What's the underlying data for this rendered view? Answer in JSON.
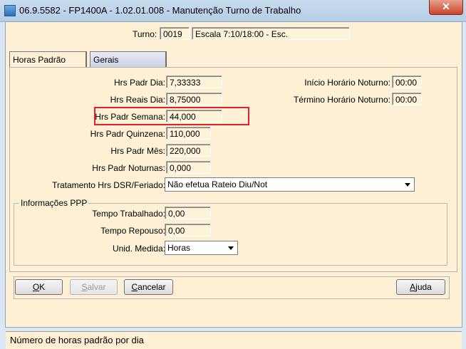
{
  "window": {
    "title": "06.9.5582 - FP1400A - 1.02.01.008 - Manutenção Turno de Trabalho",
    "close_glyph": "✕"
  },
  "header": {
    "turno_label": "Turno:",
    "turno_code": "0019",
    "turno_desc": "Escala 7:10/18:00 - Esc."
  },
  "tabs": [
    {
      "label": "Horas Padrão"
    },
    {
      "label": "Gerais"
    }
  ],
  "horas": {
    "padr_dia": {
      "label": "Hrs Padr Dia:",
      "value": "7,33333"
    },
    "reais_dia": {
      "label": "Hrs Reais Dia:",
      "value": "8,75000"
    },
    "padr_semana": {
      "label": "Hrs Padr Semana:",
      "value": "44,000"
    },
    "padr_quinzena": {
      "label": "Hrs Padr Quinzena:",
      "value": "110,000"
    },
    "padr_mes": {
      "label": "Hrs Padr Mês:",
      "value": "220,000"
    },
    "padr_noturnas": {
      "label": "Hrs Padr Noturnas:",
      "value": "0,000"
    },
    "inicio_noturno": {
      "label": "Início Horário Noturno:",
      "value": "00:00"
    },
    "termino_noturno": {
      "label": "Término Horário Noturno:",
      "value": "00:00"
    },
    "tratamento": {
      "label": "Tratamento Hrs DSR/Feriado:",
      "value": "Não efetua Rateio Diu/Not"
    }
  },
  "ppp": {
    "title": "Informações PPP",
    "tempo_trabalhado": {
      "label": "Tempo Trabalhado:",
      "value": "0,00"
    },
    "tempo_repouso": {
      "label": "Tempo Repouso:",
      "value": "0,00"
    },
    "unid_medida": {
      "label": "Unid. Medida:",
      "value": "Horas"
    }
  },
  "buttons": {
    "ok": {
      "mnemonic": "O",
      "rest": "K"
    },
    "salvar": {
      "mnemonic": "S",
      "rest": "alvar"
    },
    "cancelar": {
      "mnemonic": "C",
      "rest": "ancelar"
    },
    "ajuda": {
      "mnemonic": "A",
      "rest": "juda"
    }
  },
  "status": {
    "text": "Número de horas padrão por dia"
  },
  "colors": {
    "highlight": "#e0202a",
    "client_bg": "#fdf0d5"
  }
}
